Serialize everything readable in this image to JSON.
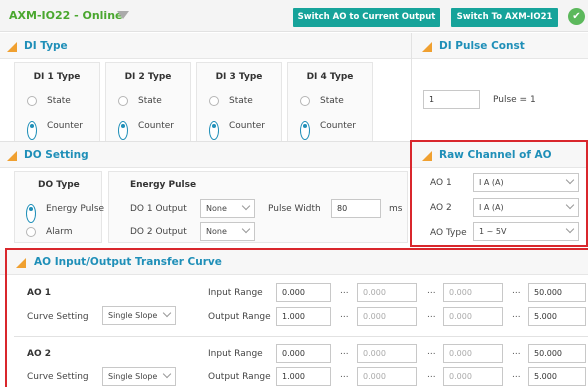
{
  "header": {
    "title": "AXM-IO22 - Online",
    "switch_ao_label": "Switch AO to Current Output",
    "switch_device_label": "Switch To AXM-IO21",
    "status_check": "✔"
  },
  "di_type": {
    "title": "DI Type",
    "channels": [
      {
        "name": "DI 1 Type",
        "state": "State",
        "counter": "Counter",
        "selected": "Counter"
      },
      {
        "name": "DI 2 Type",
        "state": "State",
        "counter": "Counter",
        "selected": "Counter"
      },
      {
        "name": "DI 3 Type",
        "state": "State",
        "counter": "Counter",
        "selected": "Counter"
      },
      {
        "name": "DI 4 Type",
        "state": "State",
        "counter": "Counter",
        "selected": "Counter"
      }
    ]
  },
  "di_pulse": {
    "title": "DI Pulse Const",
    "value": "1",
    "pulse_text": "Pulse = 1"
  },
  "do_setting": {
    "title": "DO Setting",
    "do_type_label": "DO Type",
    "energy_pulse_option": "Energy Pulse",
    "alarm_option": "Alarm",
    "energy_pulse_label": "Energy Pulse",
    "do1_output_label": "DO 1 Output",
    "do1_output_value": "None",
    "do2_output_label": "DO 2 Output",
    "do2_output_value": "None",
    "pulse_width_label": "Pulse Width",
    "pulse_width_value": "80",
    "pulse_width_unit": "ms"
  },
  "raw_channel": {
    "title": "Raw Channel of AO",
    "ao1_label": "AO 1",
    "ao1_value": "I A (A)",
    "ao2_label": "AO 2",
    "ao2_value": "I A (A)",
    "ao_type_label": "AO Type",
    "ao_type_value": "1 ~ 5V"
  },
  "transfer_curve": {
    "title": "AO Input/Output Transfer Curve",
    "ellipsis": "...",
    "rows": [
      {
        "name": "AO 1",
        "curve_label": "Curve Setting",
        "curve_value": "Single Slope",
        "input_label": "Input Range",
        "output_label": "Output Range",
        "input": [
          "0.000",
          "0.000",
          "0.000",
          "50.000"
        ],
        "output": [
          "1.000",
          "0.000",
          "0.000",
          "5.000"
        ]
      },
      {
        "name": "AO 2",
        "curve_label": "Curve Setting",
        "curve_value": "Single Slope",
        "input_label": "Input Range",
        "output_label": "Output Range",
        "input": [
          "0.000",
          "0.000",
          "0.000",
          "50.000"
        ],
        "output": [
          "1.000",
          "0.000",
          "0.000",
          "5.000"
        ]
      }
    ]
  }
}
